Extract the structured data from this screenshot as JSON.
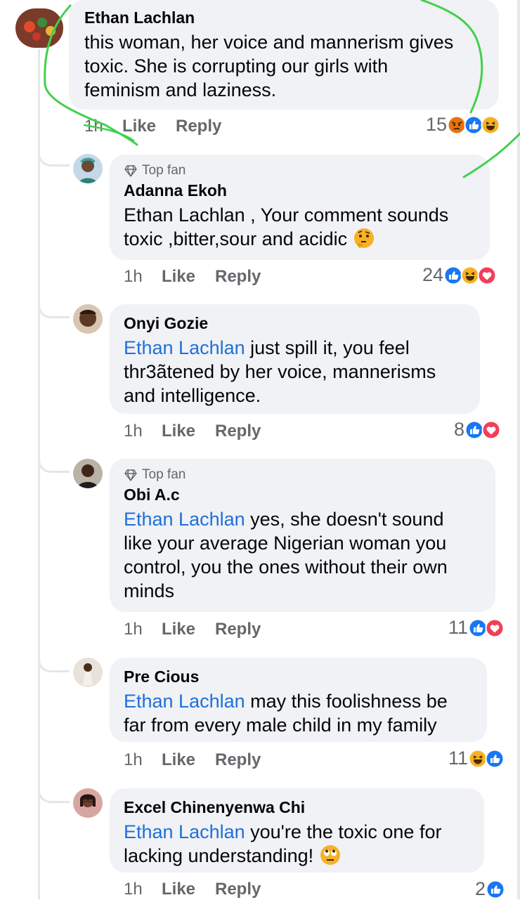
{
  "comments": [
    {
      "author": "Ethan Lachlan",
      "badge": "",
      "mention": "",
      "text_lines": [
        "this woman, her voice and mannerism gives",
        "toxic. She is corrupting our girls with",
        "feminism and laziness."
      ],
      "time": "1h",
      "like": "Like",
      "reply": "Reply",
      "reaction_count": "15",
      "reactions": [
        "angry-icon",
        "like-icon",
        "haha-icon"
      ]
    },
    {
      "author": "Adanna Ekoh",
      "badge": "Top fan",
      "mention": "",
      "text_lines": [
        "Ethan Lachlan , Your comment sounds",
        "toxic ,bitter,sour and acidic"
      ],
      "emoji": "thinking-face",
      "time": "1h",
      "like": "Like",
      "reply": "Reply",
      "reaction_count": "24",
      "reactions": [
        "like-icon",
        "haha-icon",
        "love-icon"
      ]
    },
    {
      "author": "Onyi Gozie",
      "badge": "",
      "mention": "Ethan Lachlan",
      "text_lines": [
        " just spill it, you feel",
        "thr3ãtened by her voice, mannerisms",
        "and intelligence."
      ],
      "time": "1h",
      "like": "Like",
      "reply": "Reply",
      "reaction_count": "8",
      "reactions": [
        "like-icon",
        "love-icon"
      ]
    },
    {
      "author": "Obi A.c",
      "badge": "Top fan",
      "mention": "Ethan Lachlan",
      "text_lines": [
        " yes, she doesn't sound",
        "like your average Nigerian woman you",
        "control, you the ones without their own",
        "minds"
      ],
      "time": "1h",
      "like": "Like",
      "reply": "Reply",
      "reaction_count": "11",
      "reactions": [
        "like-icon",
        "love-icon"
      ]
    },
    {
      "author": "Pre Cious",
      "badge": "",
      "mention": "Ethan Lachlan",
      "text_lines": [
        " may this foolishness be",
        "far from every male child in my family"
      ],
      "time": "1h",
      "like": "Like",
      "reply": "Reply",
      "reaction_count": "11",
      "reactions": [
        "haha-icon",
        "like-icon"
      ]
    },
    {
      "author": "Excel Chinenyenwa Chi",
      "badge": "",
      "mention": "Ethan Lachlan",
      "text_lines": [
        " you're the toxic one for",
        "lacking understanding!"
      ],
      "emoji": "eye-roll-face",
      "time": "1h",
      "like": "Like",
      "reply": "Reply",
      "reaction_count": "2",
      "reactions": [
        "like-icon"
      ]
    }
  ],
  "colors": {
    "bubble": "#f0f2f5",
    "mention": "#216fdb",
    "meta": "#65676b",
    "like": "#1877f2",
    "love": "#f33e58",
    "haha": "#f7b125",
    "angry": "#e9710f",
    "scribble": "#3fd14b"
  }
}
